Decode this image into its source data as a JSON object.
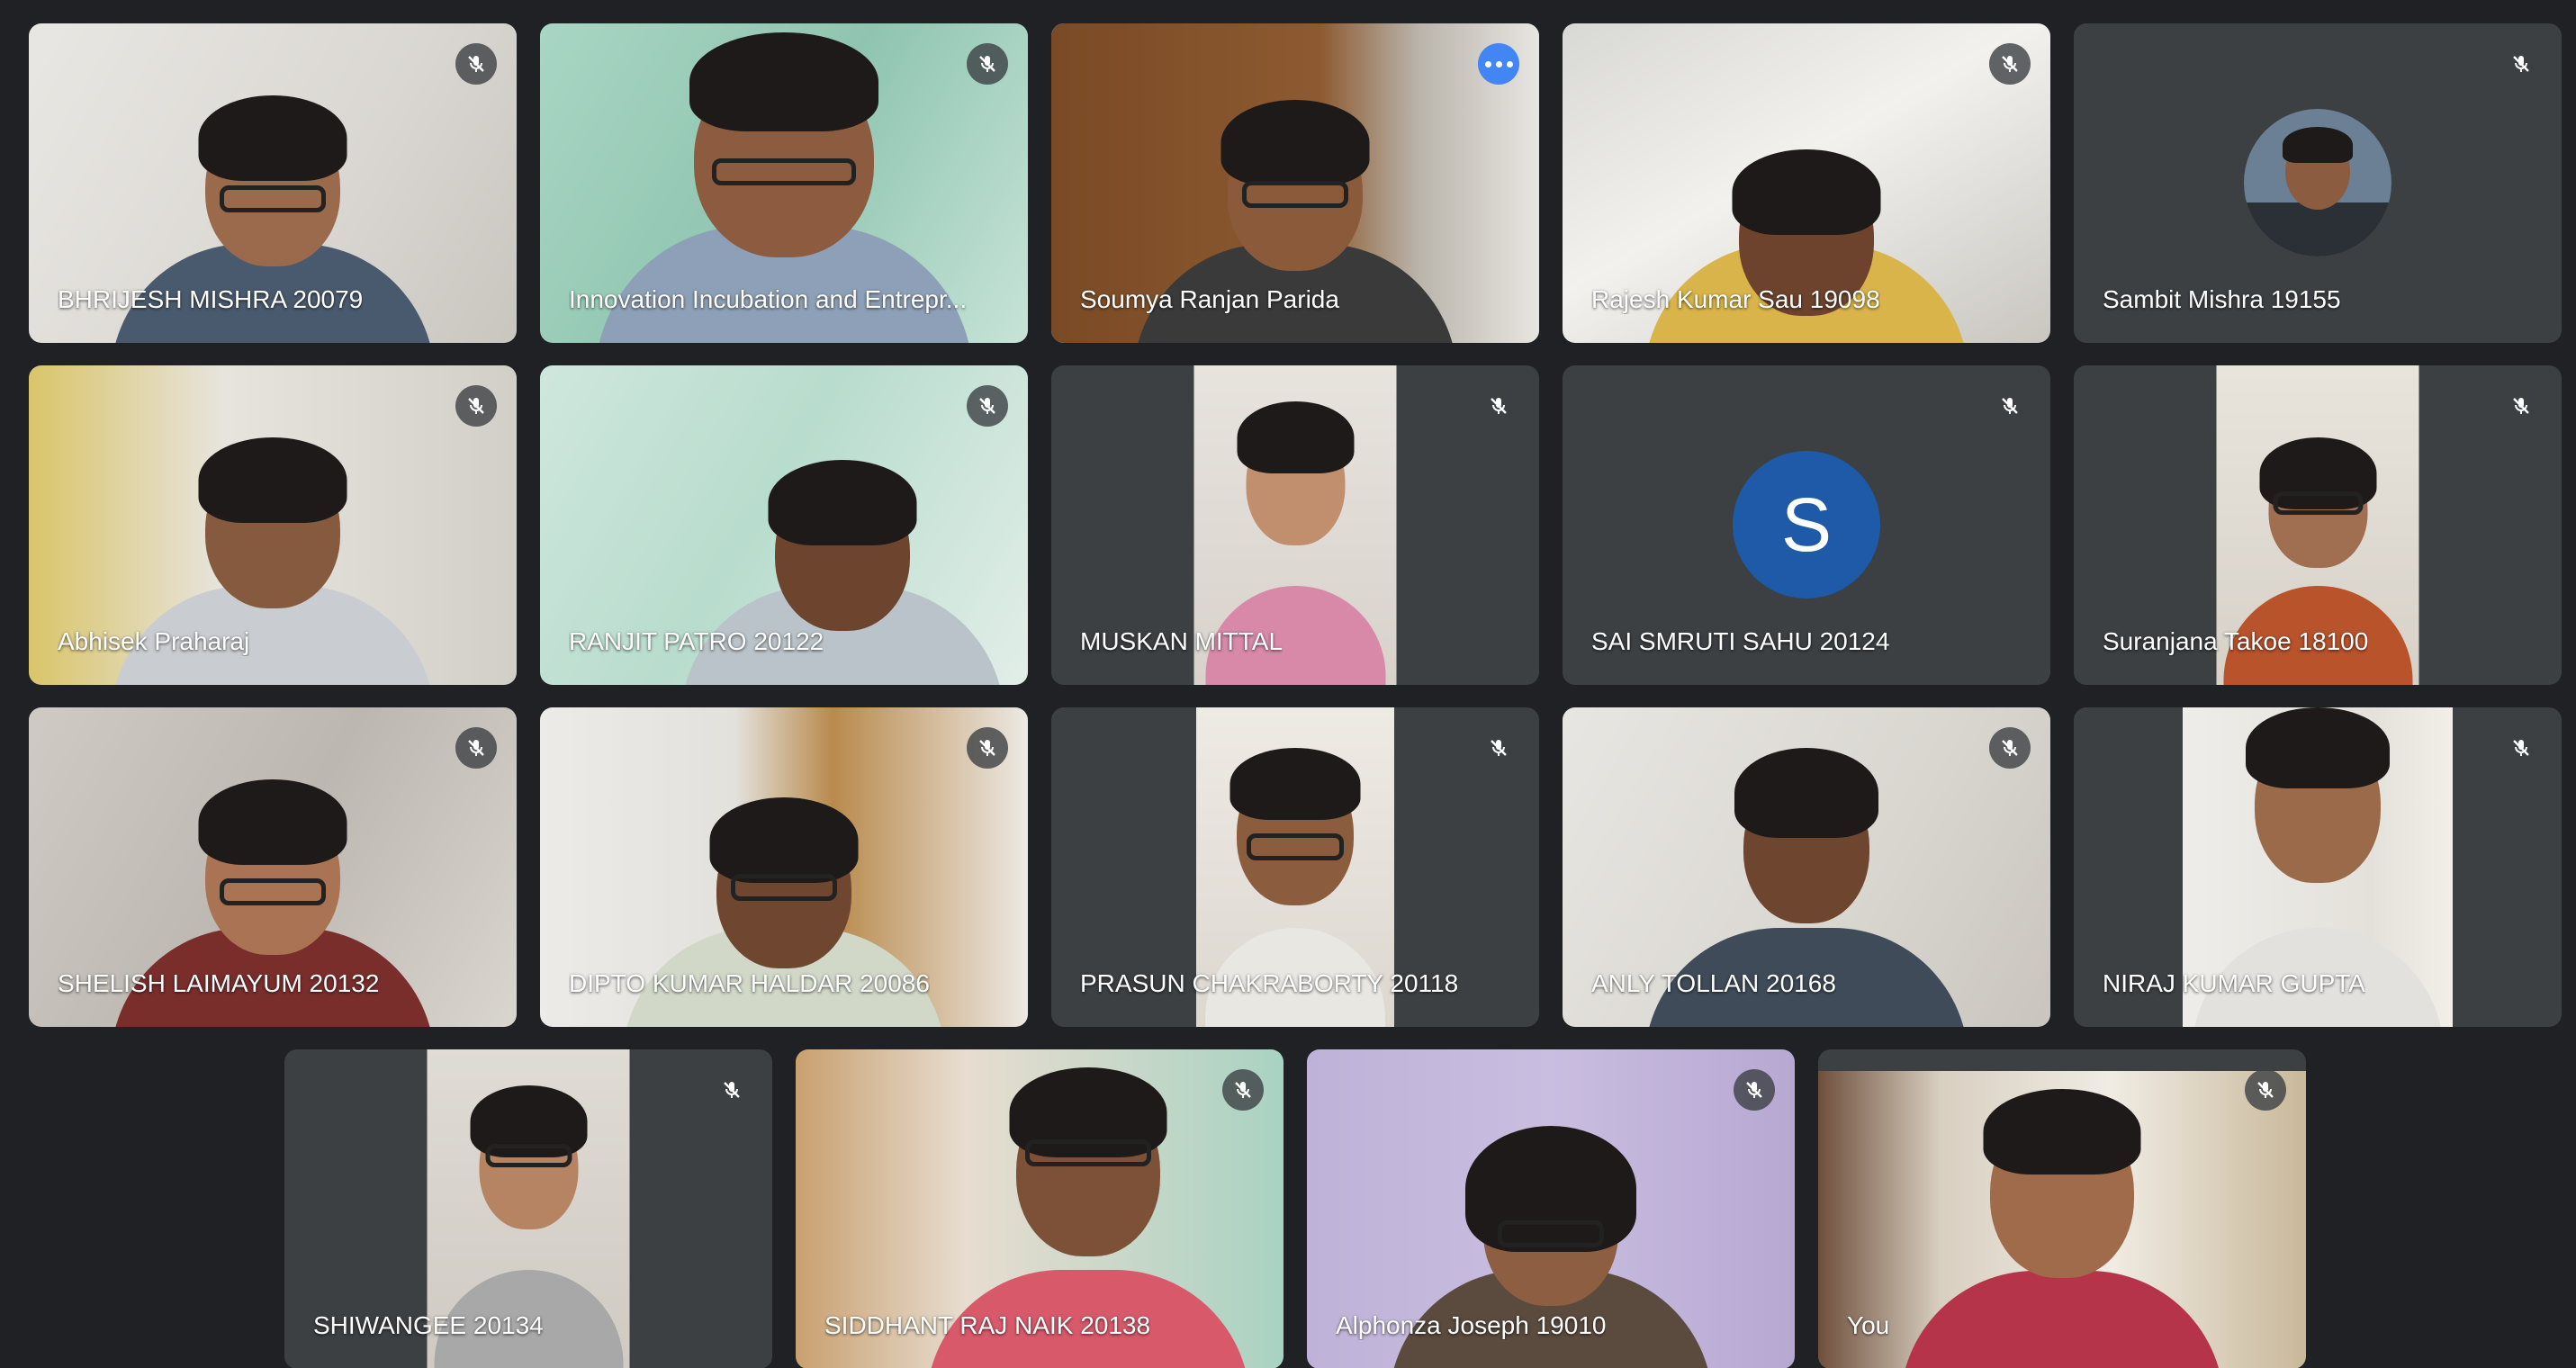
{
  "participants": [
    {
      "name": "BHRIJESH MISHRA 20079",
      "muted": true
    },
    {
      "name": "Innovation Incubation and Entrepr...",
      "muted": true
    },
    {
      "name": "Soumya Ranjan Parida",
      "muted": false,
      "speaking": true
    },
    {
      "name": "Rajesh Kumar Sau 19098",
      "muted": true
    },
    {
      "name": "Sambit Mishra 19155",
      "muted": true,
      "camera_off": true
    },
    {
      "name": "Abhisek Praharaj",
      "muted": true
    },
    {
      "name": "RANJIT PATRO 20122",
      "muted": true
    },
    {
      "name": "MUSKAN MITTAL",
      "muted": true
    },
    {
      "name": "SAI SMRUTI SAHU 20124",
      "muted": true,
      "camera_off": true,
      "avatar_letter": "S"
    },
    {
      "name": "Suranjana Takoe 18100",
      "muted": true
    },
    {
      "name": "SHELISH LAIMAYUM 20132",
      "muted": true
    },
    {
      "name": "DIPTO KUMAR HALDAR 20086",
      "muted": true
    },
    {
      "name": "PRASUN CHAKRABORTY 20118",
      "muted": true
    },
    {
      "name": "ANLY TOLLAN 20168",
      "muted": true
    },
    {
      "name": "NIRAJ KUMAR GUPTA",
      "muted": true
    },
    {
      "name": "SHIWANGEE 20134",
      "muted": true
    },
    {
      "name": "SIDDHANT RAJ NAIK 20138",
      "muted": true
    },
    {
      "name": "Alphonza Joseph 19010",
      "muted": true
    },
    {
      "name": "You",
      "muted": true
    }
  ],
  "colors": {
    "background": "#202124",
    "tile": "#3c4043",
    "active_border": "#8ab4f8",
    "more_button": "#4285f4",
    "avatar_letter_bg": "#1e5aa8"
  },
  "icons": {
    "muted": "mic-off-icon",
    "options": "more-options-icon"
  }
}
